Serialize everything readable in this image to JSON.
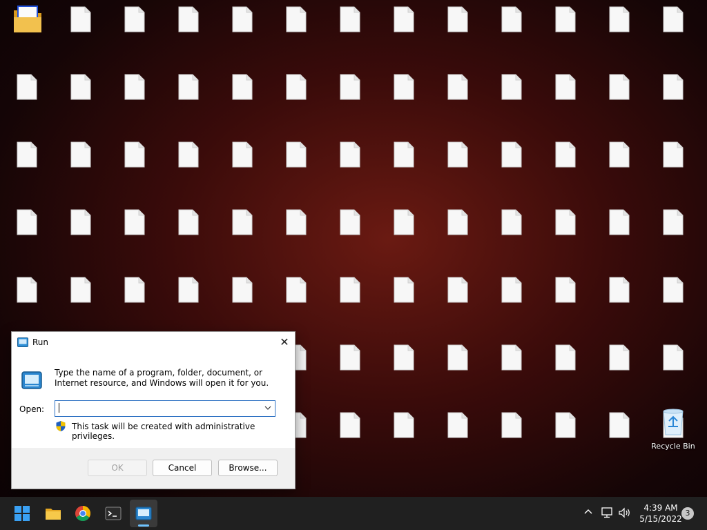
{
  "desktop": {
    "icons": [
      {
        "kind": "folder",
        "label": ""
      },
      {
        "kind": "file",
        "label": ""
      },
      {
        "kind": "file",
        "label": ""
      },
      {
        "kind": "file",
        "label": ""
      },
      {
        "kind": "file",
        "label": ""
      },
      {
        "kind": "file",
        "label": ""
      },
      {
        "kind": "file",
        "label": ""
      },
      {
        "kind": "file",
        "label": ""
      },
      {
        "kind": "file",
        "label": ""
      },
      {
        "kind": "file",
        "label": ""
      },
      {
        "kind": "file",
        "label": ""
      },
      {
        "kind": "file",
        "label": ""
      },
      {
        "kind": "file",
        "label": ""
      },
      {
        "kind": "file",
        "label": ""
      },
      {
        "kind": "file",
        "label": ""
      },
      {
        "kind": "file",
        "label": ""
      },
      {
        "kind": "file",
        "label": ""
      },
      {
        "kind": "file",
        "label": ""
      },
      {
        "kind": "file",
        "label": ""
      },
      {
        "kind": "file",
        "label": ""
      },
      {
        "kind": "file",
        "label": ""
      },
      {
        "kind": "file",
        "label": ""
      },
      {
        "kind": "file",
        "label": ""
      },
      {
        "kind": "file",
        "label": ""
      },
      {
        "kind": "file",
        "label": ""
      },
      {
        "kind": "file",
        "label": ""
      },
      {
        "kind": "file",
        "label": ""
      },
      {
        "kind": "file",
        "label": ""
      },
      {
        "kind": "file",
        "label": ""
      },
      {
        "kind": "file",
        "label": ""
      },
      {
        "kind": "file",
        "label": ""
      },
      {
        "kind": "file",
        "label": ""
      },
      {
        "kind": "file",
        "label": ""
      },
      {
        "kind": "file",
        "label": ""
      },
      {
        "kind": "file",
        "label": ""
      },
      {
        "kind": "file",
        "label": ""
      },
      {
        "kind": "file",
        "label": ""
      },
      {
        "kind": "file",
        "label": ""
      },
      {
        "kind": "file",
        "label": ""
      },
      {
        "kind": "file",
        "label": ""
      },
      {
        "kind": "file",
        "label": ""
      },
      {
        "kind": "file",
        "label": ""
      },
      {
        "kind": "file",
        "label": ""
      },
      {
        "kind": "file",
        "label": ""
      },
      {
        "kind": "file",
        "label": ""
      },
      {
        "kind": "file",
        "label": ""
      },
      {
        "kind": "file",
        "label": ""
      },
      {
        "kind": "file",
        "label": ""
      },
      {
        "kind": "file",
        "label": ""
      },
      {
        "kind": "file",
        "label": ""
      },
      {
        "kind": "file",
        "label": ""
      },
      {
        "kind": "file",
        "label": ""
      },
      {
        "kind": "file",
        "label": ""
      },
      {
        "kind": "file",
        "label": ""
      },
      {
        "kind": "file",
        "label": ""
      },
      {
        "kind": "file",
        "label": ""
      },
      {
        "kind": "file",
        "label": ""
      },
      {
        "kind": "file",
        "label": ""
      },
      {
        "kind": "file",
        "label": ""
      },
      {
        "kind": "file",
        "label": ""
      },
      {
        "kind": "file",
        "label": ""
      },
      {
        "kind": "file",
        "label": ""
      },
      {
        "kind": "file",
        "label": ""
      },
      {
        "kind": "file",
        "label": ""
      },
      {
        "kind": "file",
        "label": ""
      },
      {
        "kind": "file",
        "label": ""
      },
      {
        "kind": "file",
        "label": ""
      },
      {
        "kind": "file",
        "label": ""
      },
      {
        "kind": "file",
        "label": ""
      },
      {
        "kind": "file",
        "label": ""
      },
      {
        "kind": "file",
        "label": ""
      },
      {
        "kind": "file",
        "label": ""
      },
      {
        "kind": "file",
        "label": ""
      },
      {
        "kind": "file",
        "label": ""
      },
      {
        "kind": "file",
        "label": ""
      },
      {
        "kind": "file",
        "label": ""
      },
      {
        "kind": "file",
        "label": ""
      },
      {
        "kind": "file",
        "label": ""
      },
      {
        "kind": "file",
        "label": ""
      },
      {
        "kind": "file",
        "label": ""
      },
      {
        "kind": "file",
        "label": ""
      },
      {
        "kind": "recycle",
        "label": "Recycle Bin"
      }
    ]
  },
  "run_dialog": {
    "title": "Run",
    "close_glyph": "✕",
    "description": "Type the name of a program, folder, document, or Internet resource, and Windows will open it for you.",
    "open_label": "Open:",
    "open_value": "",
    "admin_note": "This task will be created with administrative privileges.",
    "ok_label": "OK",
    "cancel_label": "Cancel",
    "browse_label": "Browse..."
  },
  "taskbar": {
    "apps": [
      "start-icon",
      "file-explorer-icon",
      "chrome-icon",
      "terminal-icon",
      "run-icon"
    ],
    "clock_time": "4:39 AM",
    "clock_date": "5/15/2022",
    "notification_count": "3"
  },
  "colors": {
    "accent": "#2b6fc2",
    "taskbar": "#202020",
    "wallpaper": "#3a0b0a"
  }
}
